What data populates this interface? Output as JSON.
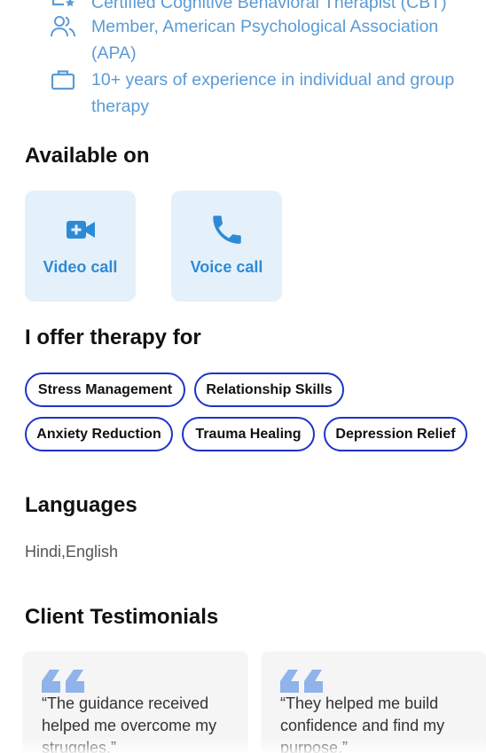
{
  "credentials": [
    {
      "icon": "certificate-icon",
      "text": "Certified Cognitive Behavioral Therapist (CBT)"
    },
    {
      "icon": "users-icon",
      "text": "Member, American Psychological Association (APA)"
    },
    {
      "icon": "briefcase-icon",
      "text": "10+ years of experience in individual and group therapy"
    }
  ],
  "available": {
    "heading": "Available on",
    "options": [
      {
        "icon": "video-camera-icon",
        "label": "Video call"
      },
      {
        "icon": "phone-icon",
        "label": "Voice call"
      }
    ]
  },
  "therapy": {
    "heading": "I offer therapy for",
    "chips": [
      "Stress Management",
      "Relationship Skills",
      "Anxiety Reduction",
      "Trauma Healing",
      "Depression Relief"
    ]
  },
  "languages": {
    "heading": "Languages",
    "value": "Hindi,English"
  },
  "testimonials": {
    "heading": "Client Testimonials",
    "items": [
      "“The guidance received helped me overcome my struggles.”",
      "“They helped me build confidence and find my purpose.”"
    ]
  },
  "colors": {
    "accent_text": "#5b9bd5",
    "card_bg": "#e4f1fb",
    "card_label": "#2f8ad6",
    "chip_border": "#1f33c8",
    "quote_icon": "#8fb3ea"
  }
}
